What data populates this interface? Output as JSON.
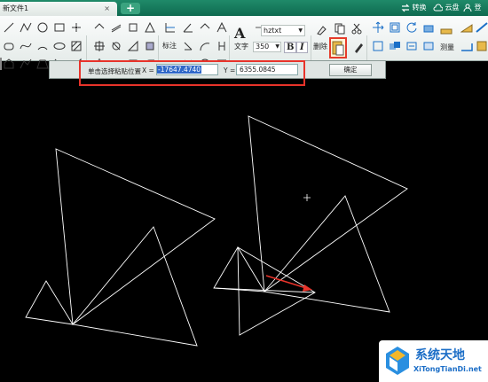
{
  "titlebar": {
    "doc_tab": "新文件1",
    "doc_tab_close": "×",
    "new_tab": "+",
    "convert": "转换",
    "cloud": "云盘",
    "login": "登录"
  },
  "ribbon": {
    "annotate_label": "标注",
    "text_label": "文字",
    "text_a": "A",
    "font_name": "hztxt",
    "font_size": "350",
    "bold": "B",
    "italic": "I",
    "delete_label": "删除",
    "measure_label": "测量"
  },
  "command_bar": {
    "prompt": "单击选择粘贴位置",
    "x_label": "X =",
    "x_value": "-17647.4740",
    "y_label": "Y =",
    "y_value": "6355.0845",
    "ok_button": "确定"
  },
  "colors": {
    "title_green": "#13775a",
    "highlight_red": "#e8332a",
    "canvas": "#000000",
    "selection_blue": "#2f68c8"
  },
  "watermark": {
    "title": "系统天地",
    "url": "XiTongTianDi.net"
  }
}
